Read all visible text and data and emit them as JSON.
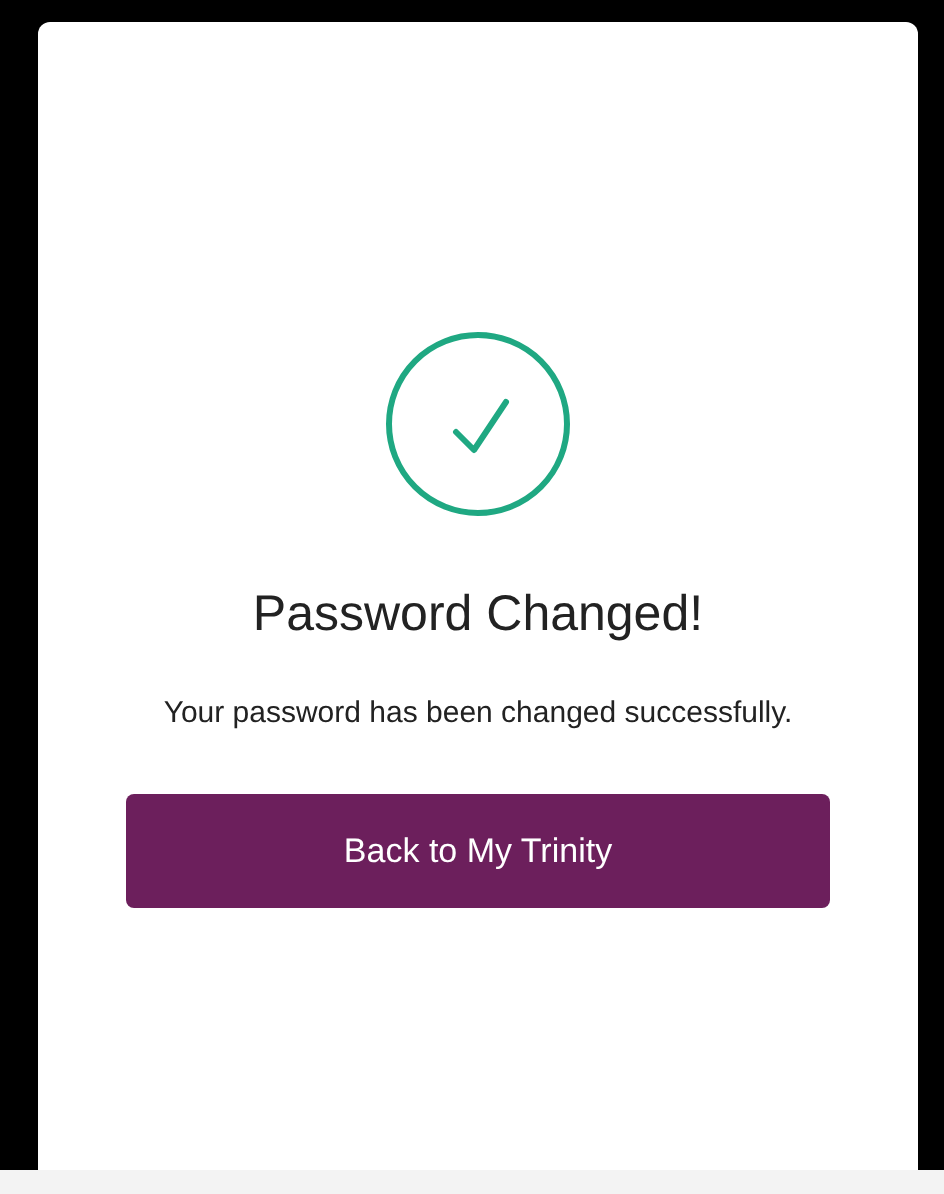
{
  "title": "Password Changed!",
  "message": "Your password has been changed successfully.",
  "button": {
    "label": "Back to My Trinity"
  }
}
